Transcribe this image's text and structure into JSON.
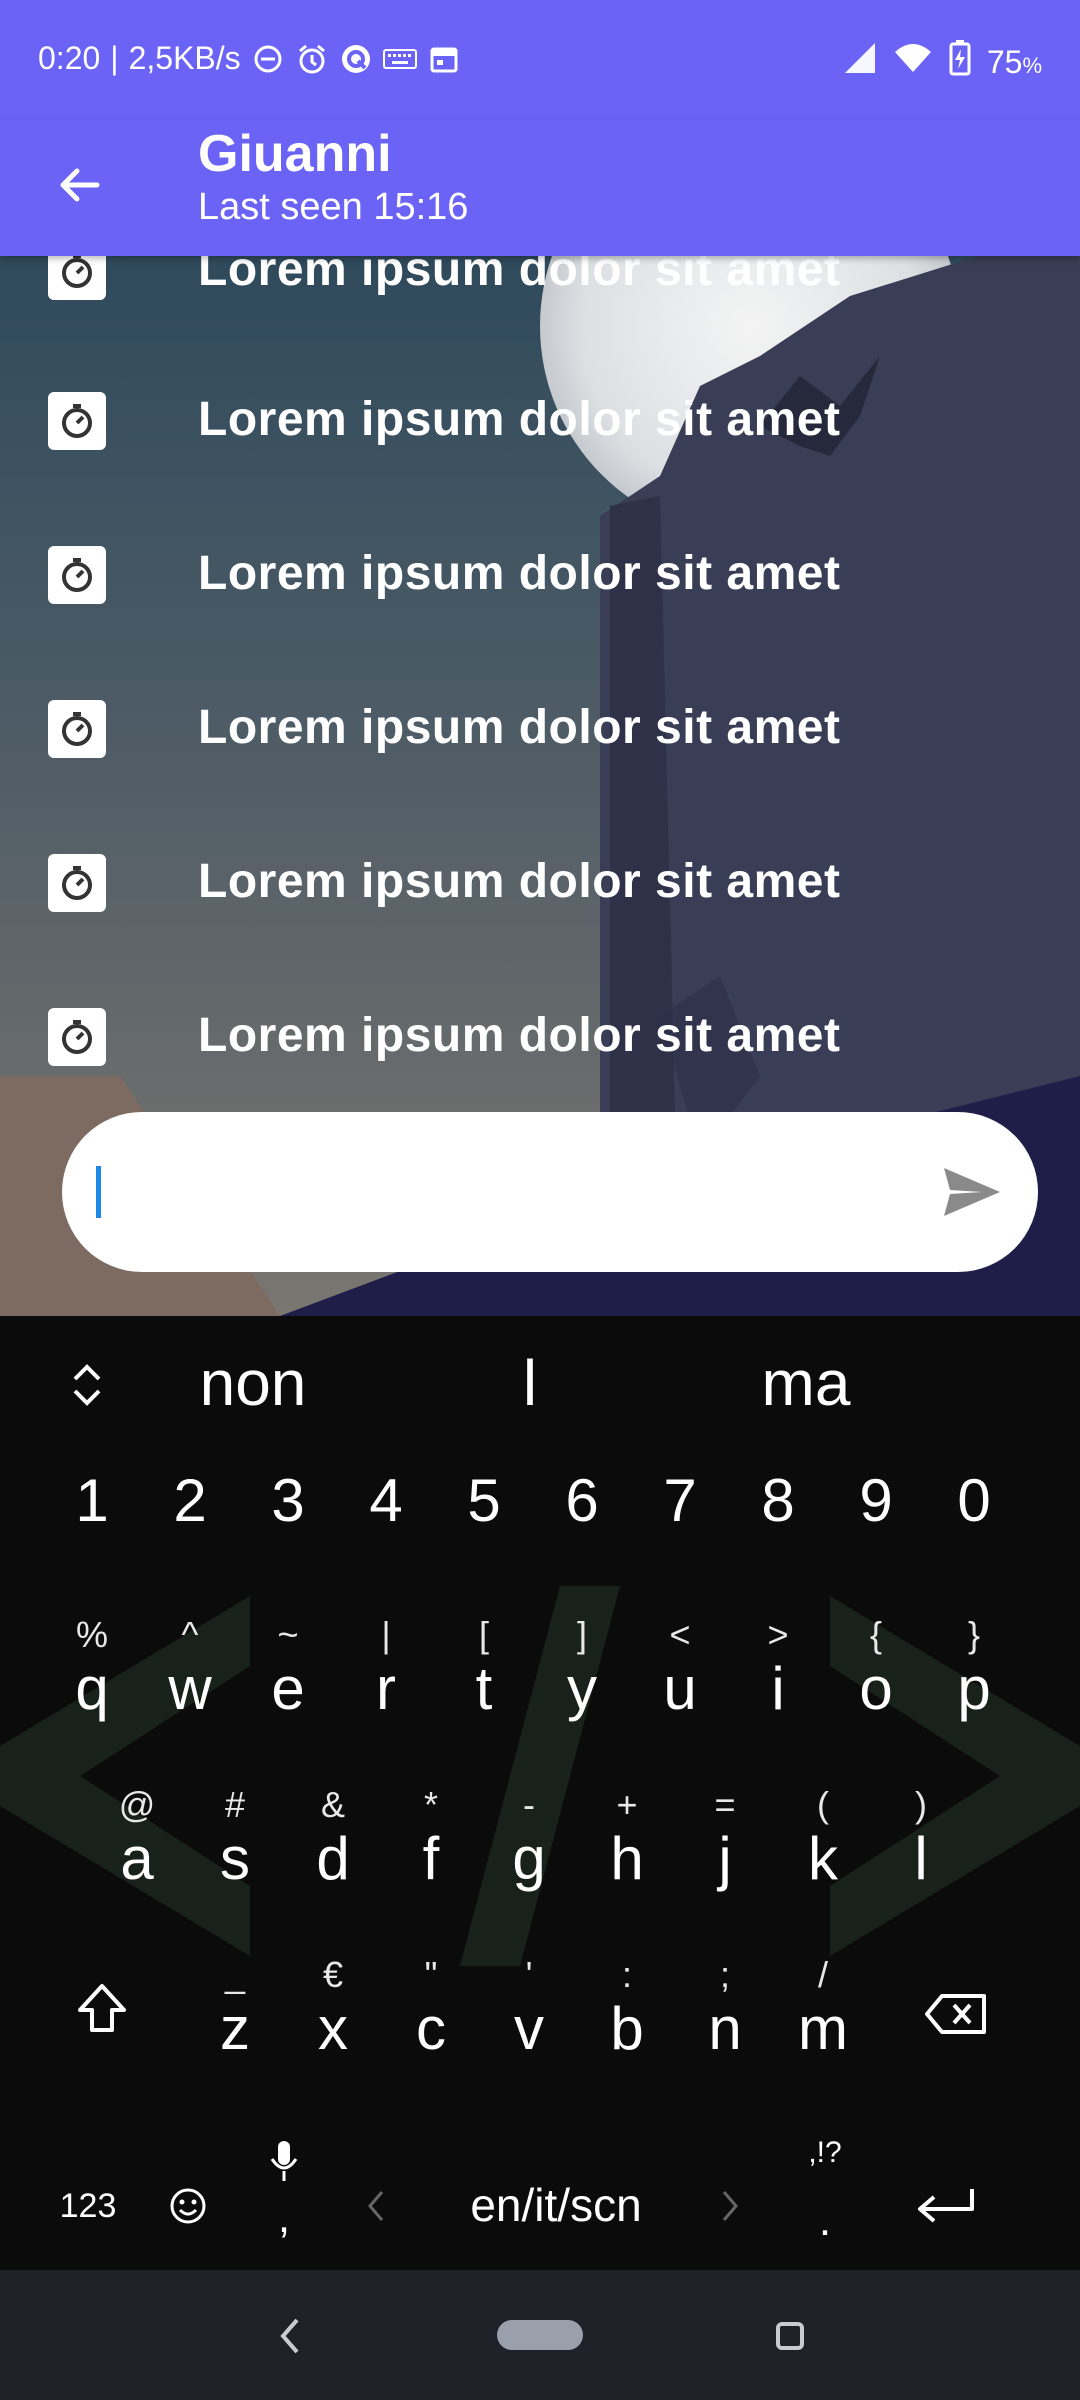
{
  "status_bar": {
    "time": "0:20",
    "network_speed": "2,5KB/s",
    "battery": "75",
    "battery_unit": "%",
    "icons_left": [
      "dnd-icon",
      "alarm-icon",
      "app-icon",
      "keyboard-icon",
      "calendar-icon"
    ],
    "icons_right": [
      "signal-icon",
      "wifi-icon",
      "battery-charging-icon"
    ]
  },
  "header": {
    "title": "Giuanni",
    "subtitle": "Last seen 15:16"
  },
  "list": {
    "items": [
      {
        "label": "Lorem ipsum dolor sit amet",
        "icon": "timer-icon"
      },
      {
        "label": "Lorem ipsum dolor sit amet",
        "icon": "timer-icon"
      },
      {
        "label": "Lorem ipsum dolor sit amet",
        "icon": "timer-icon"
      },
      {
        "label": "Lorem ipsum dolor sit amet",
        "icon": "timer-icon"
      },
      {
        "label": "Lorem ipsum dolor sit amet",
        "icon": "timer-icon"
      },
      {
        "label": "Lorem ipsum dolor sit amet",
        "icon": "timer-icon"
      }
    ]
  },
  "composer": {
    "value": "",
    "placeholder": ""
  },
  "keyboard": {
    "suggestions": [
      "non",
      "l",
      "ma"
    ],
    "numbers": [
      "1",
      "2",
      "3",
      "4",
      "5",
      "6",
      "7",
      "8",
      "9",
      "0"
    ],
    "row1": [
      {
        "sec": "%",
        "pri": "q"
      },
      {
        "sec": "^",
        "pri": "w"
      },
      {
        "sec": "~",
        "pri": "e"
      },
      {
        "sec": "|",
        "pri": "r"
      },
      {
        "sec": "[",
        "pri": "t"
      },
      {
        "sec": "]",
        "pri": "y"
      },
      {
        "sec": "<",
        "pri": "u"
      },
      {
        "sec": ">",
        "pri": "i"
      },
      {
        "sec": "{",
        "pri": "o"
      },
      {
        "sec": "}",
        "pri": "p"
      }
    ],
    "row2": [
      {
        "sec": "@",
        "pri": "a"
      },
      {
        "sec": "#",
        "pri": "s"
      },
      {
        "sec": "&",
        "pri": "d"
      },
      {
        "sec": "*",
        "pri": "f"
      },
      {
        "sec": "-",
        "pri": "g"
      },
      {
        "sec": "+",
        "pri": "h"
      },
      {
        "sec": "=",
        "pri": "j"
      },
      {
        "sec": "(",
        "pri": "k"
      },
      {
        "sec": ")",
        "pri": "l"
      }
    ],
    "row3": [
      {
        "sec": "_",
        "pri": "z"
      },
      {
        "sec": "€",
        "pri": "x"
      },
      {
        "sec": "\"",
        "pri": "c"
      },
      {
        "sec": "'",
        "pri": "v"
      },
      {
        "sec": ":",
        "pri": "b"
      },
      {
        "sec": ";",
        "pri": "n"
      },
      {
        "sec": "/",
        "pri": "m"
      }
    ],
    "bottom": {
      "symbols_label": "123",
      "comma": ",",
      "language": "en/it/scn",
      "punct_hint": ",!?",
      "period": "."
    }
  },
  "colors": {
    "accent": "#6b63f5",
    "keyboard_bg": "#0b0b0b",
    "nav_bg": "#1f2129",
    "caret": "#1e88e5"
  }
}
